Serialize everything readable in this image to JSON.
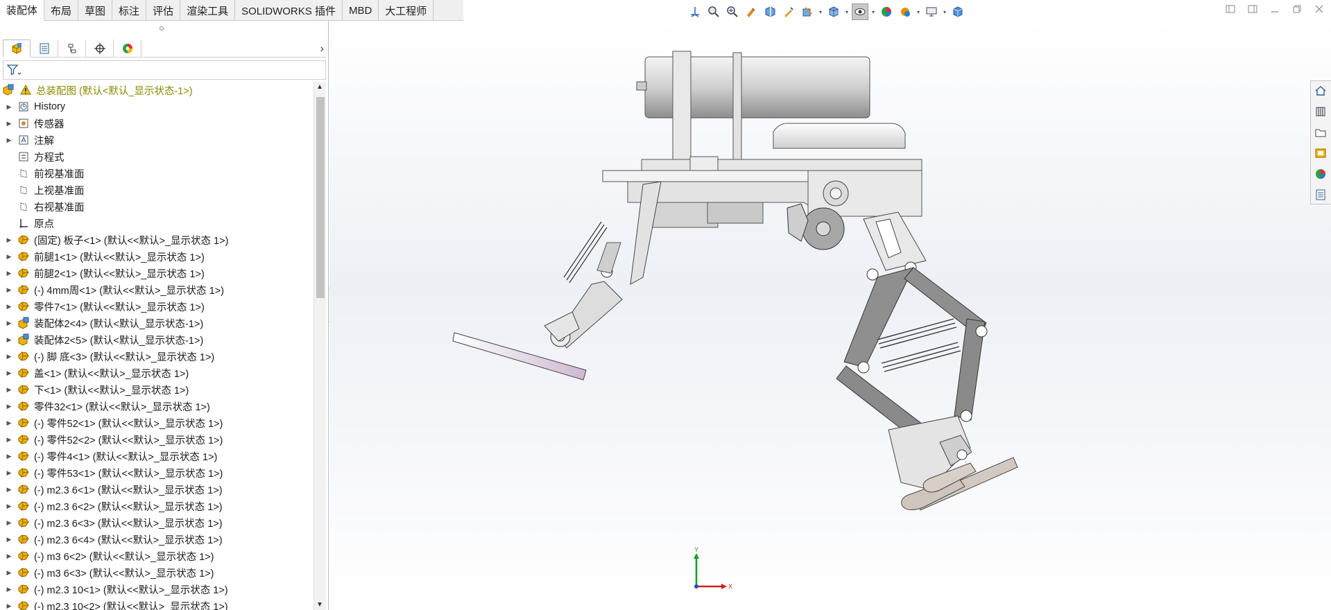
{
  "tabs": [
    {
      "label": "装配体",
      "active": true
    },
    {
      "label": "布局"
    },
    {
      "label": "草图"
    },
    {
      "label": "标注"
    },
    {
      "label": "评估"
    },
    {
      "label": "渲染工具"
    },
    {
      "label": "SOLIDWORKS 插件"
    },
    {
      "label": "MBD"
    },
    {
      "label": "大工程师"
    }
  ],
  "tree": {
    "root": "总装配图  (默认<默认_显示状态-1>)",
    "items": [
      {
        "label": "History",
        "icon": "history-icon",
        "expandable": true
      },
      {
        "label": "传感器",
        "icon": "sensor-icon",
        "expandable": true
      },
      {
        "label": "注解",
        "icon": "annotation-icon",
        "expandable": true
      },
      {
        "label": "方程式",
        "icon": "equation-icon",
        "expandable": false
      },
      {
        "label": "前视基准面",
        "icon": "plane-icon",
        "expandable": false
      },
      {
        "label": "上视基准面",
        "icon": "plane-icon",
        "expandable": false
      },
      {
        "label": "右视基准面",
        "icon": "plane-icon",
        "expandable": false
      },
      {
        "label": "原点",
        "icon": "origin-icon",
        "expandable": false
      },
      {
        "label": "(固定) 板子<1> (默认<<默认>_显示状态 1>)",
        "icon": "part-icon",
        "expandable": true
      },
      {
        "label": "前腿1<1> (默认<<默认>_显示状态 1>)",
        "icon": "part-icon",
        "expandable": true
      },
      {
        "label": "前腿2<1> (默认<<默认>_显示状态 1>)",
        "icon": "part-icon",
        "expandable": true
      },
      {
        "label": "(-) 4mm周<1> (默认<<默认>_显示状态 1>)",
        "icon": "part-icon",
        "expandable": true
      },
      {
        "label": "零件7<1> (默认<<默认>_显示状态 1>)",
        "icon": "part-icon",
        "expandable": true
      },
      {
        "label": "装配体2<4> (默认<默认_显示状态-1>)",
        "icon": "assembly-icon",
        "expandable": true
      },
      {
        "label": "装配体2<5> (默认<默认_显示状态-1>)",
        "icon": "assembly-icon",
        "expandable": true
      },
      {
        "label": "(-) 脚 底<3> (默认<<默认>_显示状态 1>)",
        "icon": "part-icon",
        "expandable": true
      },
      {
        "label": "盖<1> (默认<<默认>_显示状态 1>)",
        "icon": "part-icon",
        "expandable": true
      },
      {
        "label": "下<1> (默认<<默认>_显示状态 1>)",
        "icon": "part-icon",
        "expandable": true
      },
      {
        "label": "零件32<1> (默认<<默认>_显示状态 1>)",
        "icon": "part-icon",
        "expandable": true
      },
      {
        "label": "(-) 零件52<1> (默认<<默认>_显示状态 1>)",
        "icon": "part-icon",
        "expandable": true
      },
      {
        "label": "(-) 零件52<2> (默认<<默认>_显示状态 1>)",
        "icon": "part-icon",
        "expandable": true
      },
      {
        "label": "(-) 零件4<1> (默认<<默认>_显示状态 1>)",
        "icon": "part-icon",
        "expandable": true
      },
      {
        "label": "(-) 零件53<1> (默认<<默认>_显示状态 1>)",
        "icon": "part-icon",
        "expandable": true
      },
      {
        "label": "(-) m2.3 6<1> (默认<<默认>_显示状态 1>)",
        "icon": "part-icon",
        "expandable": true
      },
      {
        "label": "(-) m2.3 6<2> (默认<<默认>_显示状态 1>)",
        "icon": "part-icon",
        "expandable": true
      },
      {
        "label": "(-) m2.3 6<3> (默认<<默认>_显示状态 1>)",
        "icon": "part-icon",
        "expandable": true
      },
      {
        "label": "(-) m2.3 6<4> (默认<<默认>_显示状态 1>)",
        "icon": "part-icon",
        "expandable": true
      },
      {
        "label": "(-) m3 6<2> (默认<<默认>_显示状态 1>)",
        "icon": "part-icon",
        "expandable": true
      },
      {
        "label": "(-) m3 6<3> (默认<<默认>_显示状态 1>)",
        "icon": "part-icon",
        "expandable": true
      },
      {
        "label": "(-) m2.3 10<1> (默认<<默认>_显示状态 1>)",
        "icon": "part-icon",
        "expandable": true
      },
      {
        "label": "(-) m2.3 10<2> (默认<<默认>_显示状态 1>)",
        "icon": "part-icon",
        "expandable": true
      }
    ]
  },
  "triad": {
    "y_label": "Y",
    "x_label": "X"
  },
  "colors": {
    "accent": "#1565c0",
    "warning": "#f5c400",
    "part": "#e8a400"
  }
}
